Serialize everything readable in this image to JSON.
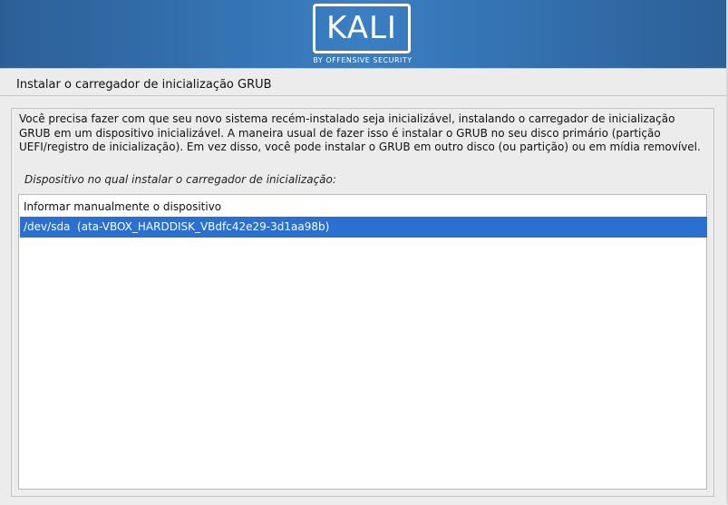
{
  "header": {
    "logo_text": "KALI",
    "logo_subtitle": "BY OFFENSIVE SECURITY",
    "colors": {
      "banner": "#3a7fc3",
      "logo": "#ffffff"
    }
  },
  "step": {
    "title": "Instalar o carregador de inicialização GRUB"
  },
  "main": {
    "description": "Você precisa fazer com que seu novo sistema recém-instalado seja inicializável, instalando o carregador de inicialização GRUB em um dispositivo inicializável. A maneira usual de fazer isso é instalar o GRUB no seu disco primário (partição UEFI/registro de inicialização). Em vez disso, você pode instalar o GRUB em outro disco (ou partição) ou em mídia removível.",
    "prompt": "Dispositivo no qual instalar o carregador de inicialização:",
    "options": [
      {
        "label": "Informar manualmente o dispositivo",
        "selected": false
      },
      {
        "label": "/dev/sda  (ata-VBOX_HARDDISK_VBdfc42e29-3d1aa98b)",
        "selected": true
      }
    ],
    "colors": {
      "selection": "#2b6fd1",
      "selection_text": "#ffffff"
    }
  }
}
